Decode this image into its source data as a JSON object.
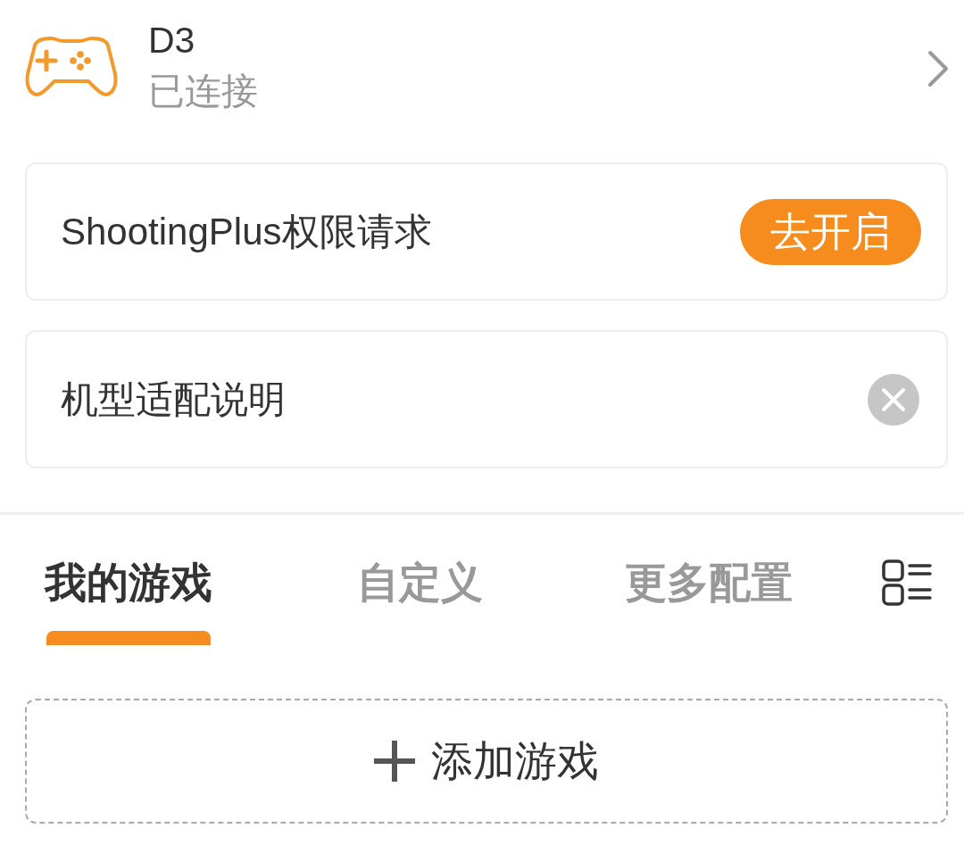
{
  "device": {
    "name": "D3",
    "status": "已连接"
  },
  "cards": [
    {
      "kind": "action",
      "label": "ShootingPlus权限请求",
      "button": "去开启"
    },
    {
      "kind": "dismissible",
      "label": "机型适配说明"
    }
  ],
  "tabs": [
    {
      "label": "我的游戏",
      "selected": true
    },
    {
      "label": "自定义",
      "selected": false
    },
    {
      "label": "更多配置",
      "selected": false
    }
  ],
  "add_game": {
    "label": "添加游戏"
  }
}
